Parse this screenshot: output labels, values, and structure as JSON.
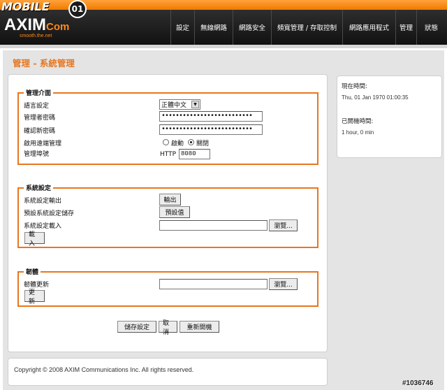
{
  "header": {
    "mobile01_text": "MOBILE",
    "mobile01_badge": "01",
    "logo_main": "AXIM",
    "logo_com": "Com",
    "tagline": "smooth.the.net",
    "nav": [
      "設定",
      "無線網路",
      "網路安全",
      "頻寬管理 / 存取控制",
      "網路應用程式",
      "管理",
      "狀態"
    ]
  },
  "page_title": "管理 - 系統管理",
  "admin_group": {
    "legend": "管理介面",
    "language_label": "語言設定",
    "language_value": "正體中文",
    "admin_pw_label": "管理者密碼",
    "admin_pw_value": "••••••••••••••••••••••••••",
    "confirm_pw_label": "確認新密碼",
    "confirm_pw_value": "••••••••••••••••••••••••••",
    "remote_label": "啟用遠端管理",
    "remote_on": "啟動",
    "remote_off": "關閉",
    "remote_selected": "off",
    "port_label": "管理埠號",
    "port_prefix": "HTTP",
    "port_value": "8080"
  },
  "system_group": {
    "legend": "系統設定",
    "export_label": "系統設定輸出",
    "export_button": "輸出",
    "default_label": "預設系統設定儲存",
    "default_button": "預設值",
    "load_label": "系統設定載入",
    "load_path": "",
    "browse_button": "瀏覽...",
    "load_button": "載入"
  },
  "firmware_group": {
    "legend": "韌體",
    "update_label": "韌體更新",
    "update_path": "",
    "browse_button": "瀏覽...",
    "update_button": "更新"
  },
  "actions": {
    "save": "儲存設定",
    "cancel": "取消",
    "reboot": "重新開機"
  },
  "status": {
    "time_label": "現在時間:",
    "time_value": "Thu, 01 Jan 1970 01:00:35",
    "uptime_label": "已開機時間:",
    "uptime_value": "1 hour, 0 min"
  },
  "footer": {
    "copyright": "Copyright © 2008 AXIM Communications Inc. All rights reserved."
  },
  "watermark": "#1036746",
  "colors": {
    "accent": "#e8761e",
    "header_bg": "#1b1b1b",
    "page_bg": "#e4e4e4"
  }
}
